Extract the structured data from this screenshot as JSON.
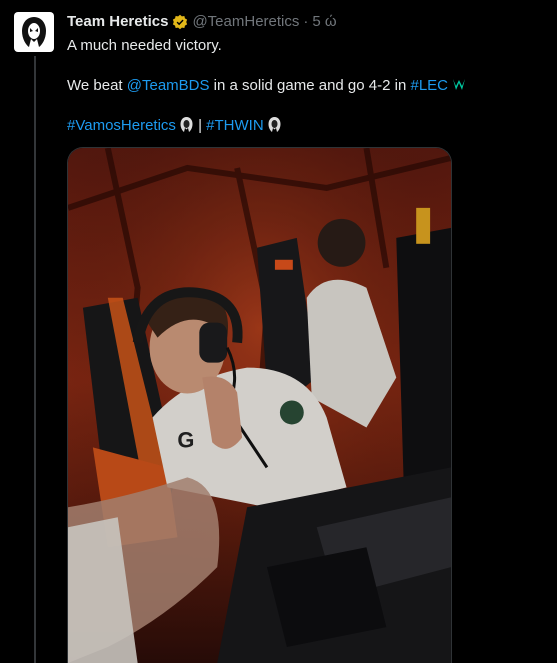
{
  "tweet": {
    "author": {
      "display_name": "Team Heretics",
      "handle": "@TeamHeretics",
      "dot": "·",
      "time": "5 ώ",
      "avatar_icon": "heretics-logo-icon",
      "verified_icon": "verified-gold-badge-icon"
    },
    "text": {
      "line1": "A much needed victory.",
      "line2_prefix": "We beat ",
      "mention": "@TeamBDS",
      "line2_middle": " in a solid game and go 4-2 in ",
      "hashtag_lec": "#LEC",
      "hashtag_vamos": "#VamosHeretics",
      "separator": " | ",
      "hashtag_thwin": "#THWIN"
    },
    "media": {
      "type": "photo",
      "icon": "esports-player-photo"
    }
  },
  "colors": {
    "background": "#000000",
    "text": "#e7e9ea",
    "secondary": "#71767b",
    "link": "#1d9bf0",
    "verified": "#e2b719",
    "thread_line": "#333639"
  }
}
